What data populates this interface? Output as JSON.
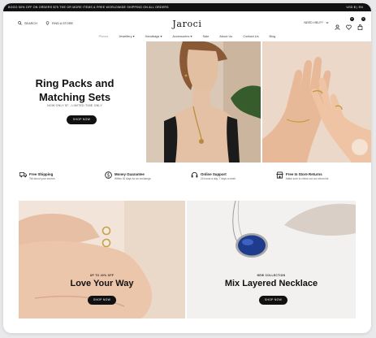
{
  "topbar": {
    "message": "BOGO 50% OFF ON ORDERS $75 THE OR MORE ITEMS & FREE WORLDWIDE SHIPPING ON ALL ORDERS",
    "currency": "USD $  |  EN"
  },
  "header": {
    "search_label": "SEARCH",
    "store_label": "FIND A STORE",
    "logo": "Jaroci",
    "need_help": "NEED HELP?",
    "wishlist_count": "0",
    "cart_count": "0"
  },
  "nav": {
    "items": [
      "Pieces",
      "Jewellery",
      "Handbags",
      "Accessories",
      "Sale",
      "About Us",
      "Contact Us",
      "Blog"
    ]
  },
  "hero": {
    "title_line1": "Ring Packs and",
    "title_line2": "Matching Sets",
    "subtitle": "NOW ONLY $7 - LIMITED TIME ONLY",
    "button": "SHOP NOW"
  },
  "features": [
    {
      "icon": "truck-icon",
      "title": "Free Shipping",
      "desc": "Tell about your service."
    },
    {
      "icon": "dollar-icon",
      "title": "Money Guarantee",
      "desc": "Within 30 days for an exchange."
    },
    {
      "icon": "headset-icon",
      "title": "Online Support",
      "desc": "24 hours a day, 7 days a week"
    },
    {
      "icon": "store-icon",
      "title": "Free In Store Returns",
      "desc": "Make sure to check out our return list"
    }
  ],
  "banners": [
    {
      "kicker": "UP TO 40% OFF",
      "title": "Love Your Way",
      "button": "SHOP NOW"
    },
    {
      "kicker": "NEW COLLECTION",
      "title": "Mix Layered Necklace",
      "button": "SHOP NOW"
    }
  ]
}
